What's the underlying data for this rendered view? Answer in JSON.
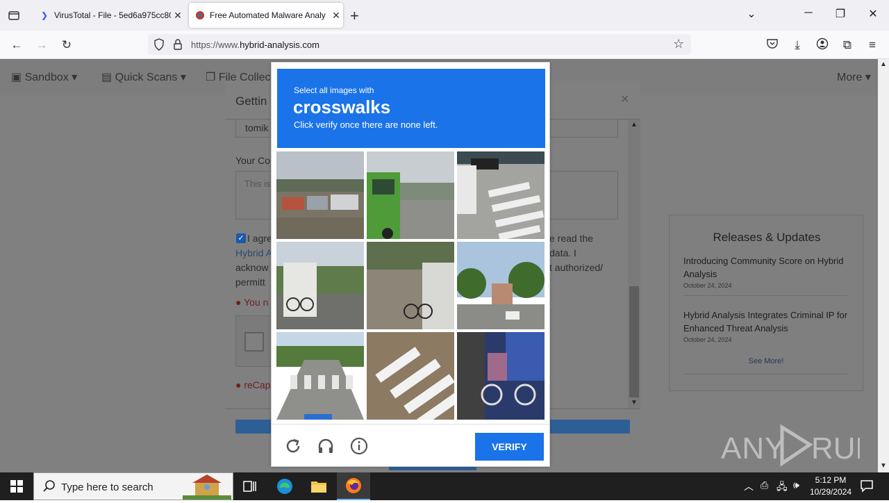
{
  "browser": {
    "tabs": [
      {
        "label": "VirusTotal - File - 5ed6a975cc80"
      },
      {
        "label": "Free Automated Malware Analy"
      }
    ],
    "url_prefix": "https://www.",
    "url_domain": "hybrid-analysis.com",
    "url_suffix": ".com"
  },
  "site": {
    "nav": [
      "Sandbox ▾",
      "Quick Scans ▾",
      "File Collec",
      "More ▾"
    ],
    "modal_title": "Gettin",
    "name_value": "tomik",
    "comment_label": "Your Co",
    "comment_placeholder": "This is",
    "agree_line1": "I agre",
    "agree_line1_right": "e read the",
    "link_text": "Hybrid A",
    "agree_line2_right": "data. I",
    "agree_line3": "acknow",
    "agree_line3_right": "t authorized/",
    "agree_line4": "permitt",
    "error1": "You n",
    "error2": "reCap"
  },
  "releases": {
    "title": "Releases & Updates",
    "items": [
      {
        "title": "Introducing Community Score on Hybrid Analysis",
        "date": "October 24, 2024"
      },
      {
        "title": "Hybrid Analysis Integrates Criminal IP for Enhanced Threat Analysis",
        "date": "October 24, 2024"
      }
    ],
    "see_more": "See More!"
  },
  "captcha": {
    "line1": "Select all images with",
    "keyword": "crosswalks",
    "line3": "Click verify once there are none left.",
    "verify_label": "VERIFY"
  },
  "watermark": "ANY RUN",
  "taskbar": {
    "search_placeholder": "Type here to search",
    "time": "5:12 PM",
    "date": "10/29/2024"
  }
}
